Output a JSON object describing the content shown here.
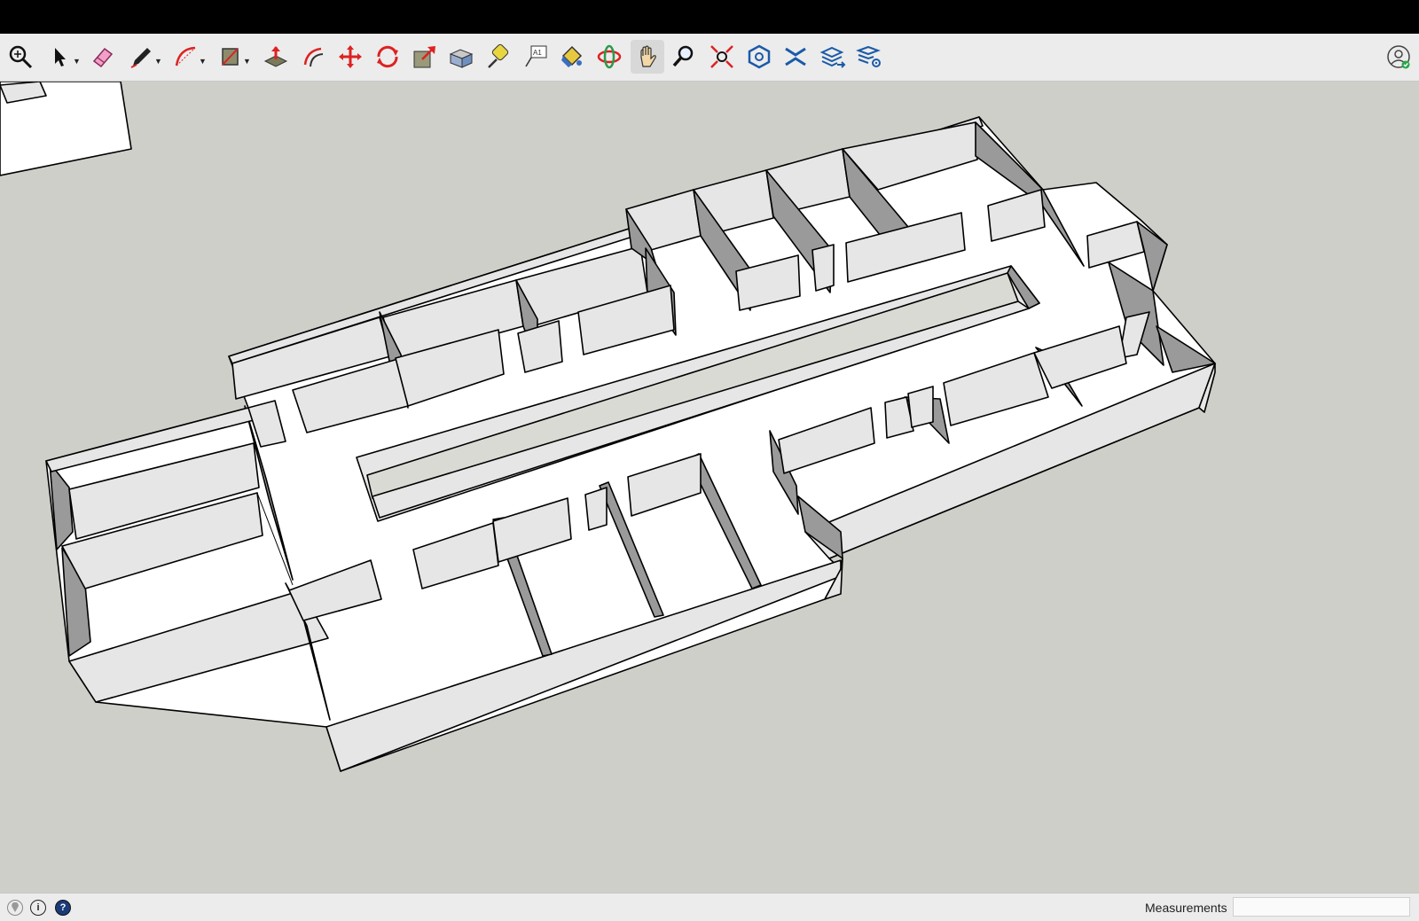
{
  "toolbar": {
    "tools": [
      {
        "name": "zoom-window-tool",
        "icon": "magnifier-plus-icon"
      },
      {
        "name": "select-tool",
        "icon": "arrow-cursor-icon"
      },
      {
        "name": "eraser-tool",
        "icon": "eraser-icon"
      },
      {
        "name": "line-tool",
        "icon": "pencil-icon"
      },
      {
        "name": "arc-tool",
        "icon": "arc-icon"
      },
      {
        "name": "rectangle-tool",
        "icon": "rectangle-icon"
      },
      {
        "name": "push-pull-tool",
        "icon": "push-pull-icon"
      },
      {
        "name": "offset-tool",
        "icon": "offset-icon"
      },
      {
        "name": "move-tool",
        "icon": "move-arrows-icon"
      },
      {
        "name": "rotate-tool",
        "icon": "rotate-icon"
      },
      {
        "name": "scale-tool",
        "icon": "scale-icon"
      },
      {
        "name": "follow-me-tool",
        "icon": "follow-me-icon"
      },
      {
        "name": "tape-measure-tool",
        "icon": "tape-measure-icon"
      },
      {
        "name": "text-tool",
        "icon": "text-label-icon"
      },
      {
        "name": "paint-bucket-tool",
        "icon": "paint-bucket-icon"
      },
      {
        "name": "orbit-tool",
        "icon": "orbit-icon"
      },
      {
        "name": "pan-tool",
        "icon": "hand-icon"
      },
      {
        "name": "zoom-tool",
        "icon": "magnifier-icon"
      },
      {
        "name": "zoom-extents-tool",
        "icon": "zoom-extents-icon"
      },
      {
        "name": "extension-warehouse-tool",
        "icon": "extension-warehouse-icon"
      },
      {
        "name": "trimble-connect-tool",
        "icon": "trimble-connect-icon"
      },
      {
        "name": "layout-send-tool",
        "icon": "layers-send-icon"
      },
      {
        "name": "extension-manager-tool",
        "icon": "layers-gear-icon"
      }
    ],
    "text_tool_glyph": "A1",
    "active_tool": "pan-tool"
  },
  "statusbar": {
    "geolocation_icon": "geo-pin-icon",
    "credits_icon": "info-icon",
    "help_icon": "help-question-icon",
    "help_glyph": "?",
    "credits_glyph": "i",
    "measurements_label": "Measurements",
    "measurements_value": ""
  },
  "colors": {
    "background": "#cfcfca",
    "floor": "#ffffff",
    "wall_light": "#e6e6e6",
    "wall_shade": "#9a9a9a",
    "edge": "#000000",
    "toolbar_bg": "#ececec"
  }
}
